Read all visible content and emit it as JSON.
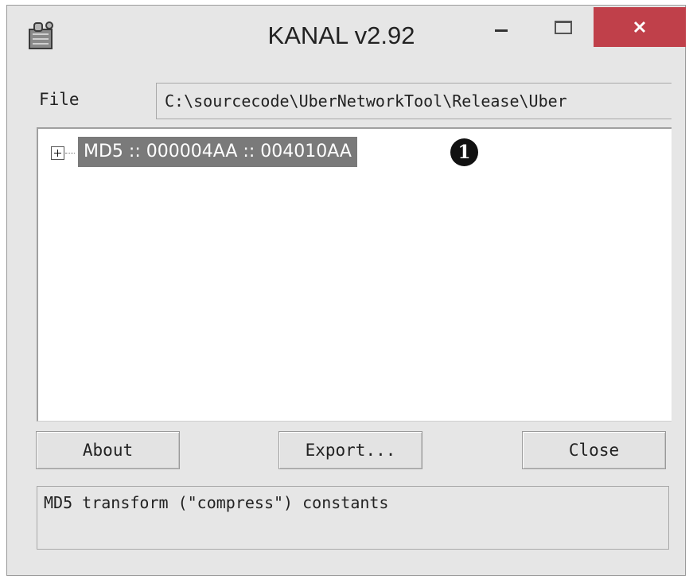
{
  "window": {
    "title": "KANAL v2.92",
    "icons": {
      "app": "puzzle-plugin-icon",
      "minimize": "minimize-icon",
      "maximize": "maximize-icon",
      "close": "close-icon"
    },
    "colors": {
      "close_button": "#c0404a",
      "selection": "#7a7a7a"
    }
  },
  "file": {
    "label": "File",
    "path": "C:\\sourcecode\\UberNetworkTool\\Release\\Uber"
  },
  "tree": {
    "items": [
      {
        "label": "MD5 :: 000004AA :: 004010AA",
        "expanded": false,
        "selected": true
      }
    ],
    "callout": "1"
  },
  "buttons": {
    "about": "About",
    "export": "Export...",
    "close": "Close"
  },
  "status": {
    "text": "MD5 transform (\"compress\") constants"
  }
}
